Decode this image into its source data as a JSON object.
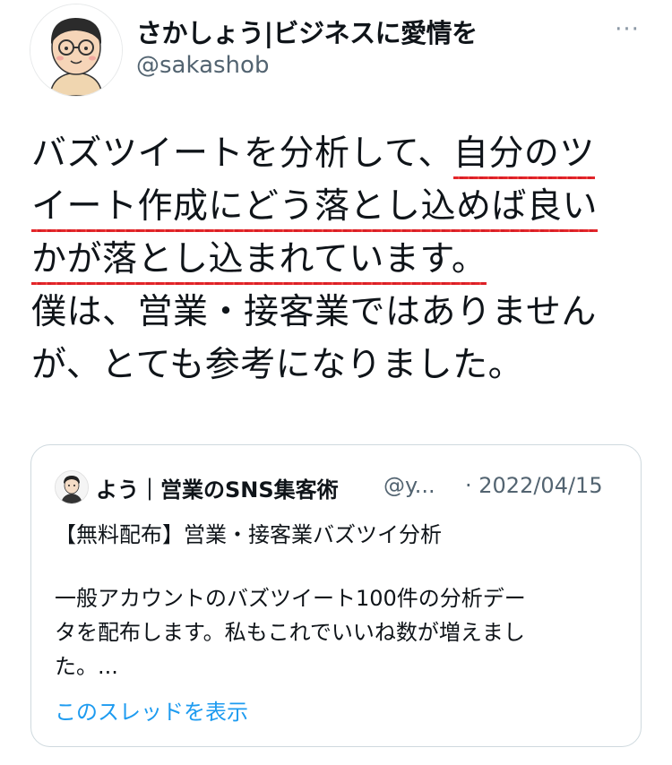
{
  "author": {
    "display_name": "さかしょう|ビジネスに愛情を",
    "handle": "@sakashob",
    "more_icon": "···"
  },
  "tweet": {
    "lines": [
      "バズツイートを分析して、",
      "自分のツ",
      "イート作成にどう落とし込めば良い",
      "かが落とし込まれています。",
      "僕は、営業・接客業ではありません",
      "が、とても参考になりました。"
    ]
  },
  "quote": {
    "name": "よう｜営業のSNS集客術",
    "handle": "@y...",
    "date": "· 2022/04/15",
    "title": "【無料配布】営業・接客業バズツイ分析",
    "body_lines": [
      "一般アカウントのバズツイート100件の分析デー",
      "タを配布します。私もこれでいいね数が増えまし",
      "た。..."
    ],
    "show_thread": "このスレッドを表示"
  },
  "colors": {
    "underline": "#e3262b",
    "link": "#1d9bf0",
    "secondary_text": "#536471"
  }
}
